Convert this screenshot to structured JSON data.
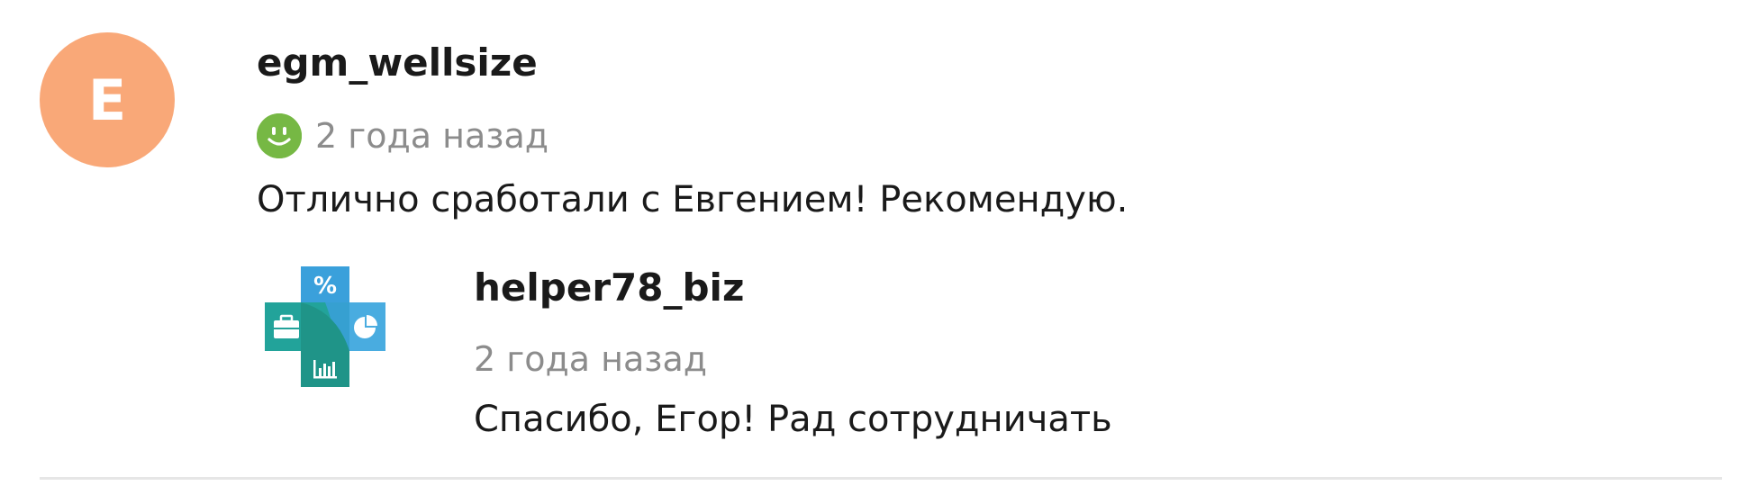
{
  "review": {
    "avatar_letter": "E",
    "avatar_color": "#f9a878",
    "author": "egm_wellsize",
    "rating_icon": "smile-icon",
    "rating_color": "#76b844",
    "date": "2 года назад",
    "text": "Отлично сработали с Евгением! Рекомендую."
  },
  "reply": {
    "logo_icon": "cross-business-logo",
    "logo_glyph": "%",
    "author": "helper78_biz",
    "date": "2 года назад",
    "text": "Спасибо, Егор! Рад сотрудничать"
  }
}
